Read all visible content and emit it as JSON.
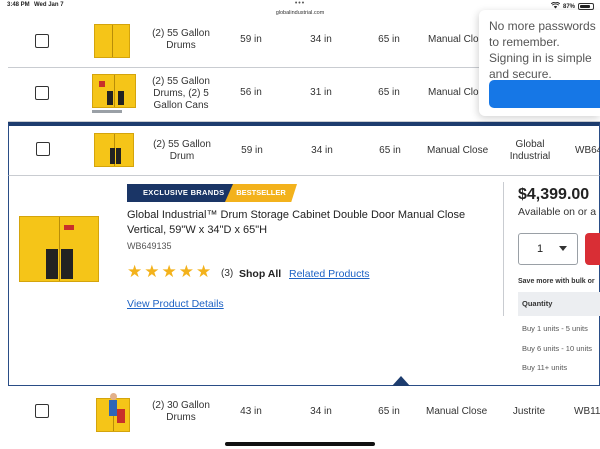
{
  "status_bar": {
    "time": "3:48 PM",
    "date": "Wed Jan 7",
    "url": "globalindustrial.com",
    "dots": "•••",
    "battery": "87%",
    "battery_fraction": 0.87
  },
  "rows": [
    {
      "description": "(2) 55 Gallon Drums",
      "height": "59 in",
      "width": "34 in",
      "depth": "65 in",
      "door": "Manual Clos"
    },
    {
      "description": "(2) 55 Gallon Drums, (2) 5 Gallon Cans",
      "height": "56 in",
      "width": "31 in",
      "depth": "65 in",
      "door": "Manual Clos"
    },
    {
      "description": "(2) 55 Gallon Drum",
      "height": "59 in",
      "width": "34 in",
      "depth": "65 in",
      "door": "Manual Close",
      "brand": "Global Industrial",
      "sku_partial": "WB64"
    },
    {
      "description": "(2) 30 Gallon Drums",
      "height": "43 in",
      "width": "34 in",
      "depth": "65 in",
      "door": "Manual Close",
      "brand": "Justrite",
      "sku_partial": "WB11"
    }
  ],
  "detail": {
    "badge_exclusive": "EXCLUSIVE BRANDS",
    "badge_bestseller": "BESTSELLER",
    "title": "Global Industrial™ Drum Storage Cabinet Double Door Manual Close Vertical, 59\"W x 34\"D x 65\"H",
    "sku": "WB649135",
    "rating": 5,
    "review_count": "(3)",
    "shop_all": "Shop All",
    "related_products": "Related Products",
    "view_details": "View Product Details",
    "price": "$4,399.00",
    "availability": "Available on or a",
    "quantity": "1",
    "bulk_note": "Save more with bulk or",
    "tier_header": "Quantity",
    "tiers": [
      "Buy 1 units - 5 units",
      "Buy 6 units - 10 units",
      "Buy 11+ units"
    ]
  },
  "popup": {
    "text": "No more passwords to remember. Signing in is simple and secure."
  },
  "colors": {
    "navy": "#1a3566",
    "gold": "#f3b21c",
    "link": "#1d62c4",
    "add_to_cart": "#d92e35",
    "popup_button": "#1677e6",
    "cabinet_yellow": "#f5c518"
  },
  "icons": {
    "checkbox": "checkbox-icon",
    "star": "star-icon",
    "caret": "chevron-down-icon",
    "wifi": "wifi-icon",
    "battery": "battery-icon"
  }
}
